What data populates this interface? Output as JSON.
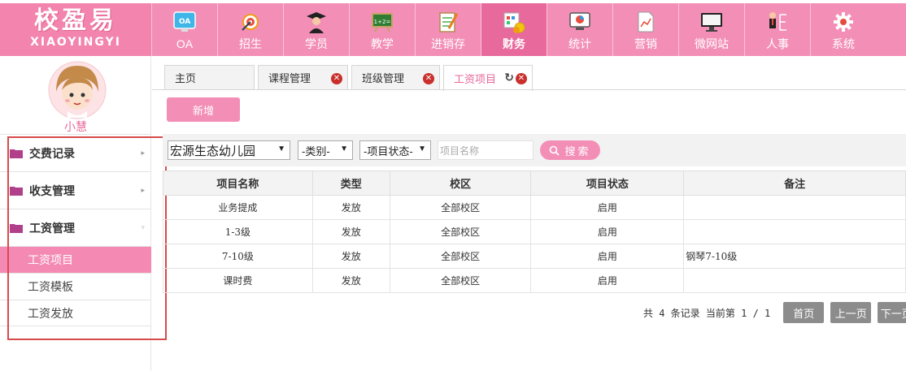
{
  "logo": {
    "cn": "校盈易",
    "en": "XIAOYINGYI"
  },
  "nav": [
    {
      "label": "OA",
      "icon": "oa-icon"
    },
    {
      "label": "招生",
      "icon": "recruit-icon"
    },
    {
      "label": "学员",
      "icon": "student-icon"
    },
    {
      "label": "教学",
      "icon": "teaching-icon"
    },
    {
      "label": "进销存",
      "icon": "inventory-icon"
    },
    {
      "label": "财务",
      "icon": "finance-icon",
      "active": true
    },
    {
      "label": "统计",
      "icon": "statistics-icon"
    },
    {
      "label": "营销",
      "icon": "marketing-icon"
    },
    {
      "label": "微网站",
      "icon": "website-icon"
    },
    {
      "label": "人事",
      "icon": "personnel-icon"
    },
    {
      "label": "系统",
      "icon": "gear-icon"
    }
  ],
  "user": {
    "name": "小慧"
  },
  "sidebar": {
    "groups": [
      {
        "label": "交费记录"
      },
      {
        "label": "收支管理"
      },
      {
        "label": "工资管理"
      }
    ],
    "sub_items": [
      {
        "label": "工资项目",
        "active": true
      },
      {
        "label": "工资模板"
      },
      {
        "label": "工资发放"
      }
    ]
  },
  "tabs": [
    {
      "label": "主页"
    },
    {
      "label": "课程管理"
    },
    {
      "label": "班级管理"
    },
    {
      "label": "工资项目",
      "active": true
    }
  ],
  "toolbar": {
    "add_label": "新增"
  },
  "filters": {
    "school": "宏源生态幼儿园",
    "type": "-类别-",
    "status": "-项目状态-",
    "search_placeholder": "项目名称",
    "search_label": "搜索"
  },
  "table": {
    "headers": [
      "项目名称",
      "类型",
      "校区",
      "项目状态",
      "备注"
    ],
    "rows": [
      [
        "业务提成",
        "发放",
        "全部校区",
        "启用",
        ""
      ],
      [
        "1-3级",
        "发放",
        "全部校区",
        "启用",
        ""
      ],
      [
        "7-10级",
        "发放",
        "全部校区",
        "启用",
        "钢琴7-10级"
      ],
      [
        "课时费",
        "发放",
        "全部校区",
        "启用",
        ""
      ]
    ]
  },
  "pager": {
    "info": "共 4 条记录 当前第 1 / 1",
    "first": "首页",
    "prev": "上一页",
    "next": "下一页"
  },
  "colors": {
    "brand": "#f38fb6",
    "brand_dark": "#e86a9c",
    "highlight": "#d84a4a"
  }
}
